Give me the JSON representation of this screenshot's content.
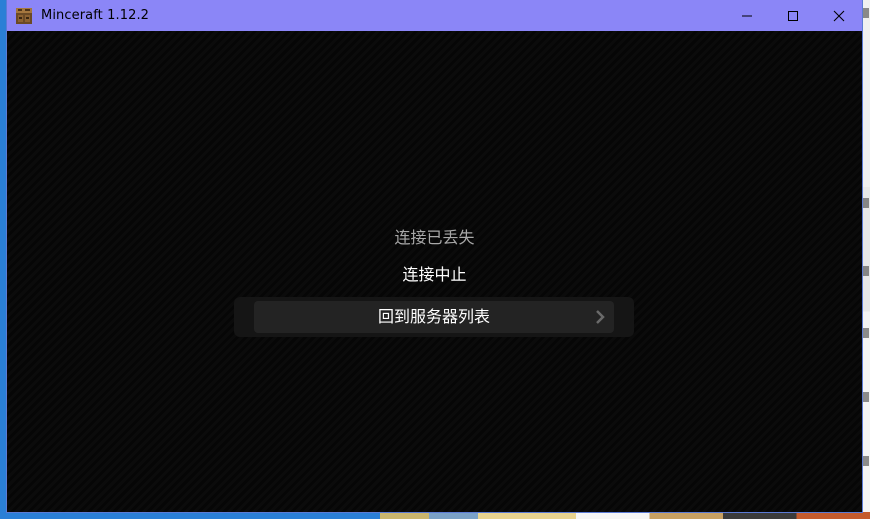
{
  "window": {
    "title": "Minceraft 1.12.2",
    "app_icon": "crafting-table-icon",
    "controls": [
      "minimize-icon",
      "maximize-icon",
      "close-icon"
    ],
    "titlebar_color": "#8b86f7"
  },
  "screen": {
    "subtitle": "连接已丢失",
    "message": "连接中止",
    "back_button": {
      "label": "回到服务器列表",
      "icon": "chevron-right-icon"
    }
  }
}
